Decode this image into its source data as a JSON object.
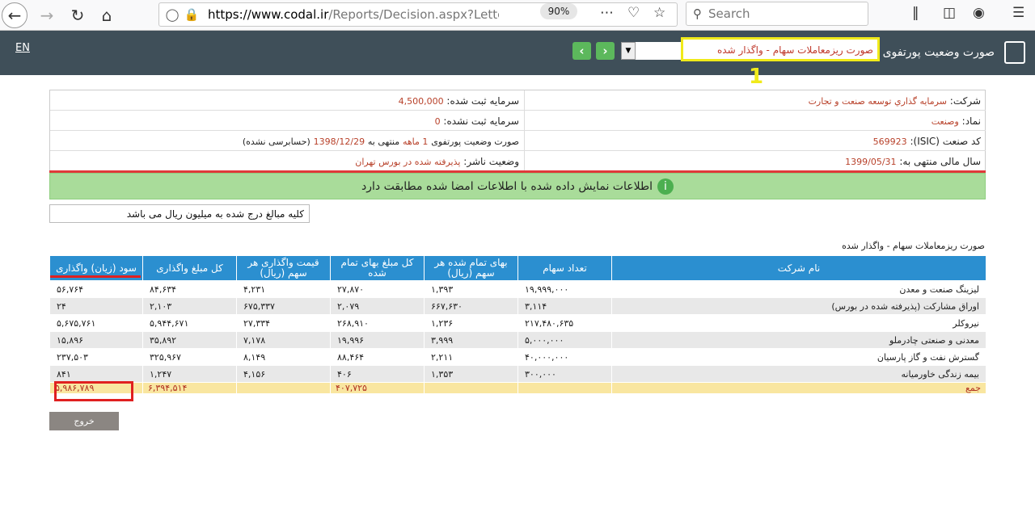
{
  "browser": {
    "url_host": "https://www.codal.ir",
    "url_rest": "/Reports/Decision.aspx?Letter",
    "zoom": "90%",
    "search_placeholder": "Search"
  },
  "header": {
    "lang_link": "EN",
    "title": "صورت وضعیت پورتفوی",
    "report_select_value": "صورت ریزمعاملات سهام - واگذار شده",
    "annotation": "1"
  },
  "info": {
    "company_label": "شرکت:",
    "company_value": "سرمایه گذاري توسعه صنعت و تجارت",
    "symbol_label": "نماد:",
    "symbol_value": "وصنعت",
    "isic_label": "کد صنعت (ISIC):",
    "isic_value": "569923",
    "fiscal_label": "سال مالی منتهی به:",
    "fiscal_value": "1399/05/31",
    "capital_label": "سرمایه ثبت شده:",
    "capital_value": "4,500,000",
    "unreg_capital_label": "سرمایه ثبت نشده:",
    "unreg_capital_value": "0",
    "report_prefix": "صورت وضعیت پورتفوی",
    "report_period": "1 ماهه",
    "report_mid": "منتهی به",
    "report_date": "1398/12/29",
    "report_status": "(حسابرسی نشده)",
    "publisher_label": "وضعیت ناشر:",
    "publisher_value": "پذیرفته شده در بورس تهران"
  },
  "status_message": "اطلاعات نمایش داده شده با اطلاعات امضا شده مطابقت دارد",
  "units_note": "کلیه مبالغ درج شده به میلیون ریال می باشد",
  "table": {
    "caption": "صورت ریزمعاملات سهام - واگذار شده",
    "headers": [
      "نام شرکت",
      "تعداد سهام",
      "بهای تمام شده هر سهم (ریال)",
      "کل مبلغ بهای تمام شده",
      "قیمت واگذاری هر سهم (ریال)",
      "کل مبلغ واگذاری",
      "سود (زیان) واگذاری"
    ],
    "rows": [
      [
        "لیزینگ صنعت و معدن",
        "۱۹,۹۹۹,۰۰۰",
        "۱,۳۹۳",
        "۲۷,۸۷۰",
        "۴,۲۳۱",
        "۸۴,۶۳۴",
        "۵۶,۷۶۴"
      ],
      [
        "اوراق مشارکت (پذیرفته شده در بورس)",
        "۳,۱۱۴",
        "۶۶۷,۶۳۰",
        "۲,۰۷۹",
        "۶۷۵,۳۳۷",
        "۲,۱۰۳",
        "۲۴"
      ],
      [
        "نیروکلر",
        "۲۱۷,۴۸۰,۶۳۵",
        "۱,۲۳۶",
        "۲۶۸,۹۱۰",
        "۲۷,۳۳۴",
        "۵,۹۴۴,۶۷۱",
        "۵,۶۷۵,۷۶۱"
      ],
      [
        "معدنی و صنعتی چادرملو",
        "۵,۰۰۰,۰۰۰",
        "۳,۹۹۹",
        "۱۹,۹۹۶",
        "۷,۱۷۸",
        "۳۵,۸۹۲",
        "۱۵,۸۹۶"
      ],
      [
        "گسترش نفت و گاز پارسیان",
        "۴۰,۰۰۰,۰۰۰",
        "۲,۲۱۱",
        "۸۸,۴۶۴",
        "۸,۱۴۹",
        "۳۲۵,۹۶۷",
        "۲۳۷,۵۰۳"
      ],
      [
        "بیمه زندگی خاورمیانه",
        "۳۰۰,۰۰۰",
        "۱,۳۵۳",
        "۴۰۶",
        "۴,۱۵۶",
        "۱,۲۴۷",
        "۸۴۱"
      ]
    ],
    "total": {
      "label": "جمع",
      "total_cost": "۴۰۷,۷۲۵",
      "total_sale": "۶,۳۹۴,۵۱۴",
      "total_profit": "۵,۹۸۶,۷۸۹"
    }
  },
  "exit_button": "خروج"
}
